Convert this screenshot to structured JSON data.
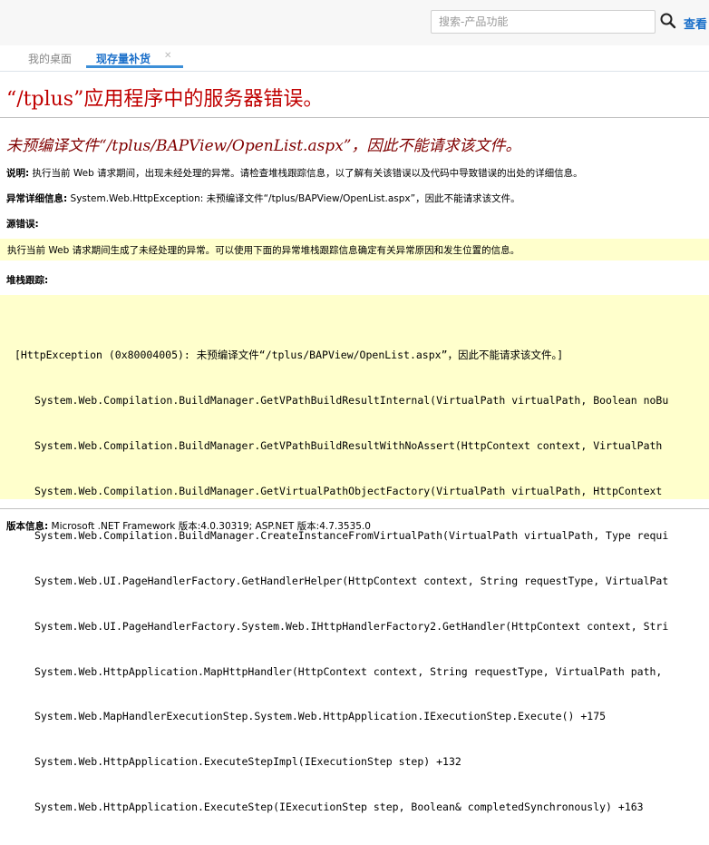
{
  "header": {
    "search_placeholder": "搜索-产品功能",
    "view_link": "查看"
  },
  "tabs": [
    {
      "label": "我的桌面"
    },
    {
      "label": "现存量补货"
    }
  ],
  "error": {
    "title": "“/tplus”应用程序中的服务器错误。",
    "subtitle": "未预编译文件“/tplus/BAPView/OpenList.aspx”，因此不能请求该文件。",
    "desc_label": "说明:",
    "desc_text": " 执行当前 Web 请求期间，出现未经处理的异常。请检查堆栈跟踪信息，以了解有关该错误以及代码中导致错误的出处的详细信息。",
    "exc_label": "异常详细信息:",
    "exc_text": " System.Web.HttpException: 未预编译文件“/tplus/BAPView/OpenList.aspx”，因此不能请求该文件。",
    "src_label": "源错误:",
    "src_text": "执行当前 Web 请求期间生成了未经处理的异常。可以使用下面的异常堆栈跟踪信息确定有关异常原因和发生位置的信息。",
    "stack_label": "堆栈跟踪:",
    "stack_lines": [
      "[HttpException (0x80004005): 未预编译文件“/tplus/BAPView/OpenList.aspx”，因此不能请求该文件。]",
      "System.Web.Compilation.BuildManager.GetVPathBuildResultInternal(VirtualPath virtualPath, Boolean noBu",
      "System.Web.Compilation.BuildManager.GetVPathBuildResultWithNoAssert(HttpContext context, VirtualPath",
      "System.Web.Compilation.BuildManager.GetVirtualPathObjectFactory(VirtualPath virtualPath, HttpContext",
      "System.Web.Compilation.BuildManager.CreateInstanceFromVirtualPath(VirtualPath virtualPath, Type requi",
      "System.Web.UI.PageHandlerFactory.GetHandlerHelper(HttpContext context, String requestType, VirtualPat",
      "System.Web.UI.PageHandlerFactory.System.Web.IHttpHandlerFactory2.GetHandler(HttpContext context, Stri",
      "System.Web.HttpApplication.MapHttpHandler(HttpContext context, String requestType, VirtualPath path,",
      "System.Web.MapHandlerExecutionStep.System.Web.HttpApplication.IExecutionStep.Execute() +175",
      "System.Web.HttpApplication.ExecuteStepImpl(IExecutionStep step) +132",
      "System.Web.HttpApplication.ExecuteStep(IExecutionStep step, Boolean& completedSynchronously) +163"
    ],
    "version_label": "版本信息:",
    "version_text": " Microsoft .NET Framework 版本:4.0.30319; ASP.NET 版本:4.7.3535.0"
  },
  "icons": {
    "search": "search-icon",
    "tab_close": "close-icon"
  },
  "colors": {
    "title": "#c00000",
    "subtitle": "#800000",
    "highlight_bg": "#ffffcc",
    "accent": "#1a6fc9"
  }
}
